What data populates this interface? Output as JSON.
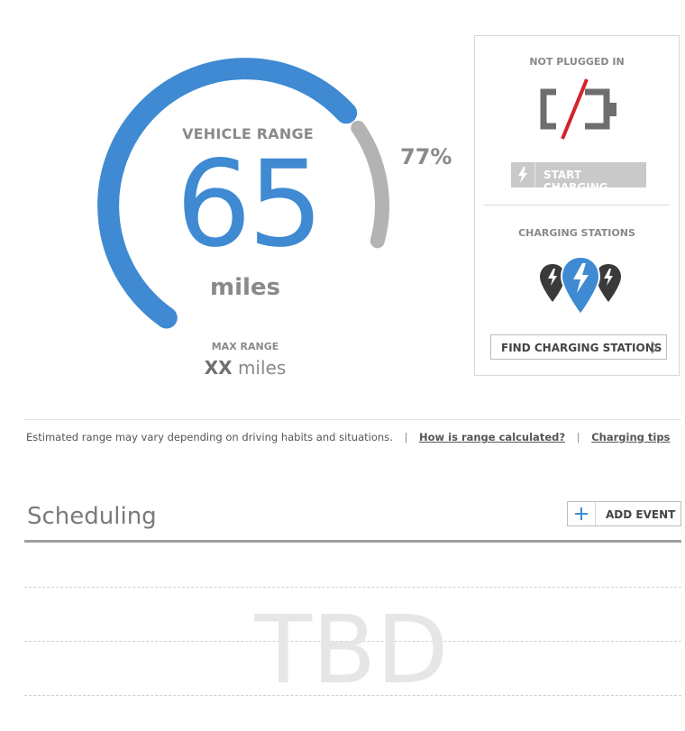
{
  "range": {
    "title": "VEHICLE RANGE",
    "value": "65",
    "unit": "miles",
    "percent_label": "77%",
    "charge_fraction": 0.77,
    "max_label": "MAX RANGE",
    "max_value": "XX",
    "max_unit": "miles",
    "colors": {
      "arc": "#3f8ad2",
      "remaining": "#b3b3b3"
    }
  },
  "charging": {
    "status": "NOT PLUGGED IN",
    "status_icon": "battery-unplugged-icon",
    "start_button": "START CHARGING",
    "stations_heading": "CHARGING STATIONS",
    "stations_icon": "charging-station-pins-icon",
    "find_button": "FIND CHARGING STATIONS",
    "colors": {
      "slash": "#d3232a",
      "pin_active": "#3f8ad2",
      "pin_inactive": "#3a3a3a"
    }
  },
  "info": {
    "text": "Estimated range may vary depending on driving habits and situations.",
    "separator": "|",
    "link_range": "How is range calculated?",
    "link_tips": "Charging tips"
  },
  "scheduling": {
    "title": "Scheduling",
    "add_button": "ADD EVENT",
    "placeholder": "TBD"
  }
}
